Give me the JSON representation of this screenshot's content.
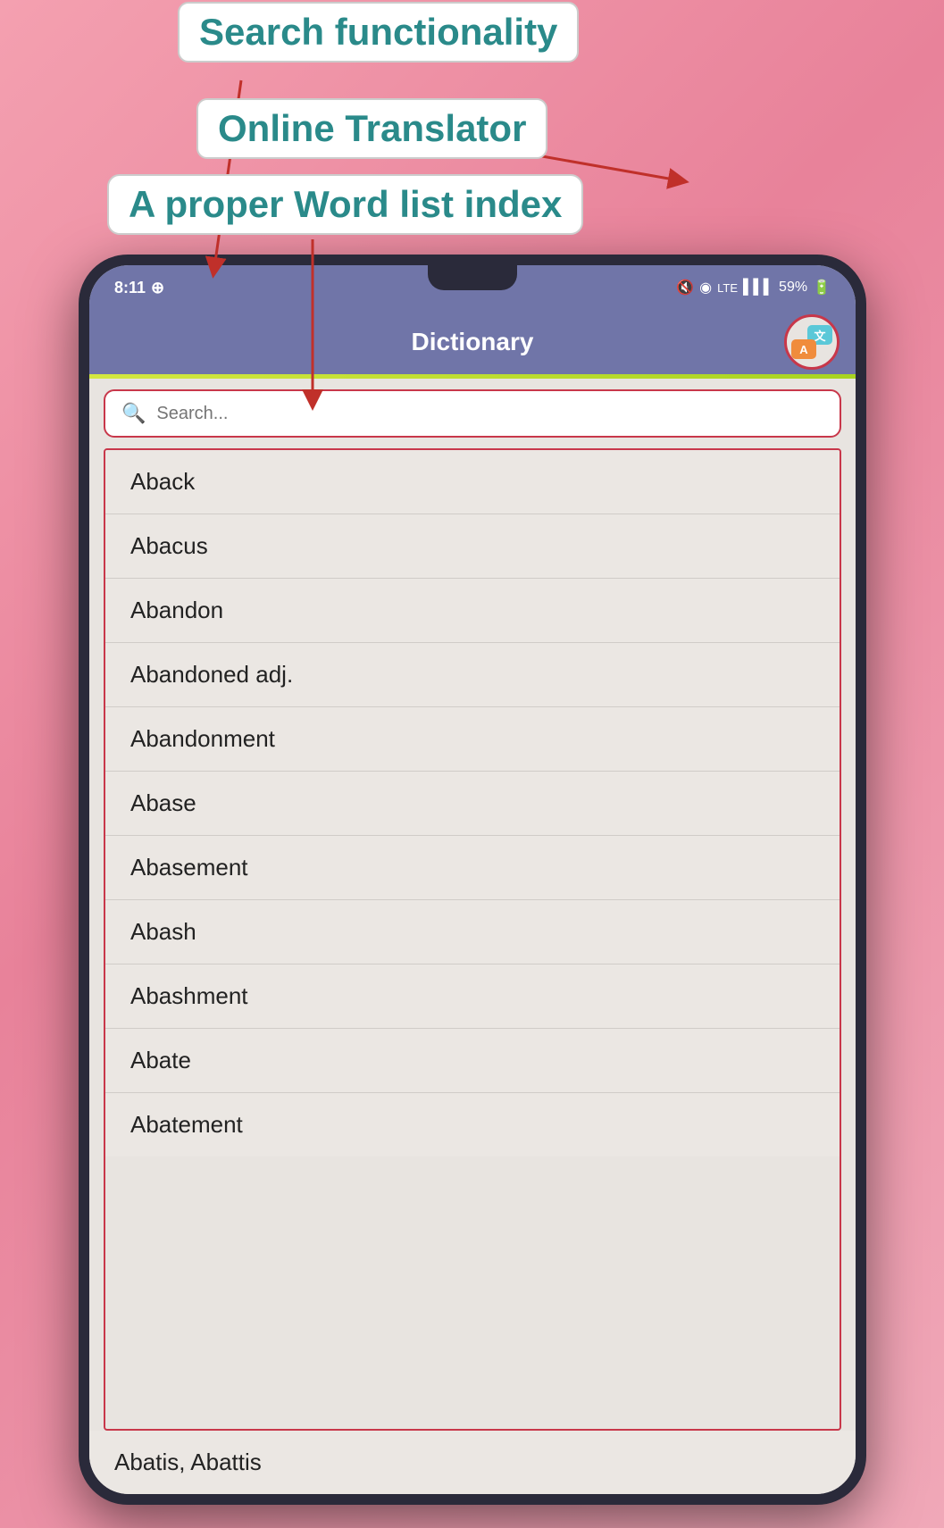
{
  "annotations": {
    "search_label": "Search functionality",
    "translator_label": "Online Translator",
    "wordlist_label": "A proper Word list index"
  },
  "status_bar": {
    "time": "8:11",
    "battery": "59%",
    "whatsapp_icon": "whatsapp",
    "mute_icon": "mute",
    "wifi_icon": "wifi",
    "lte_icon": "LTE",
    "signal_icon": "signal"
  },
  "header": {
    "title": "Dictionary",
    "translate_button_label": "translate"
  },
  "search": {
    "placeholder": "Search...",
    "icon": "search-icon"
  },
  "word_list": {
    "items": [
      "Aback",
      "Abacus",
      "Abandon",
      "Abandoned adj.",
      "Abandonment",
      "Abase",
      "Abasement",
      "Abash",
      "Abashment",
      "Abate",
      "Abatement"
    ],
    "partial_item": "Abatis, Abattis"
  },
  "colors": {
    "header_bg": "#7075a8",
    "accent_red": "#c8374a",
    "teal_text": "#2a8a8a",
    "list_bg": "#ebe7e3"
  }
}
